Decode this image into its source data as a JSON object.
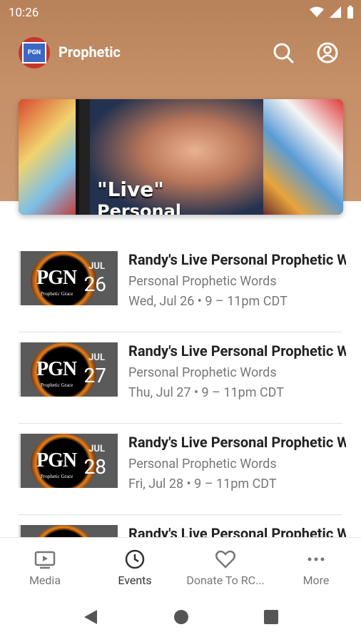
{
  "status_bar": {
    "time": "10:26"
  },
  "app": {
    "title": "Prophetic",
    "logo_text": "PGN"
  },
  "hero": {
    "caption_line1": "\"Live\"",
    "caption_line2": "Personal"
  },
  "events": [
    {
      "title": "Randy's Live Personal Prophetic Words",
      "subtitle": "Personal Prophetic Words",
      "datetime": "Wed, Jul 26 • 9 – 11pm CDT",
      "month": "JUL",
      "day": "26",
      "thumb_logo": "PGN",
      "thumb_sub": "Prophetic Grace"
    },
    {
      "title": "Randy's Live Personal Prophetic Words",
      "subtitle": "Personal Prophetic Words",
      "datetime": "Thu, Jul 27 • 9 – 11pm CDT",
      "month": "JUL",
      "day": "27",
      "thumb_logo": "PGN",
      "thumb_sub": "Prophetic Grace"
    },
    {
      "title": "Randy's Live Personal Prophetic Words",
      "subtitle": "Personal Prophetic Words",
      "datetime": "Fri, Jul 28 • 9 – 11pm CDT",
      "month": "JUL",
      "day": "28",
      "thumb_logo": "PGN",
      "thumb_sub": "Prophetic Grace"
    },
    {
      "title": "Randy's Live Personal Prophetic Words",
      "subtitle": "",
      "datetime": "",
      "month": "",
      "day": "",
      "thumb_logo": "",
      "thumb_sub": ""
    }
  ],
  "bottom_nav": [
    {
      "label": "Media",
      "icon": "media-icon",
      "active": false
    },
    {
      "label": "Events",
      "icon": "clock-icon",
      "active": true
    },
    {
      "label": "Donate To RC...",
      "icon": "heart-icon",
      "active": false
    },
    {
      "label": "More",
      "icon": "more-icon",
      "active": false
    }
  ],
  "colors": {
    "header_gradient_top": "#b7825a",
    "header_gradient_bottom": "#c99772",
    "text_primary": "#222222",
    "text_secondary": "#777777"
  }
}
